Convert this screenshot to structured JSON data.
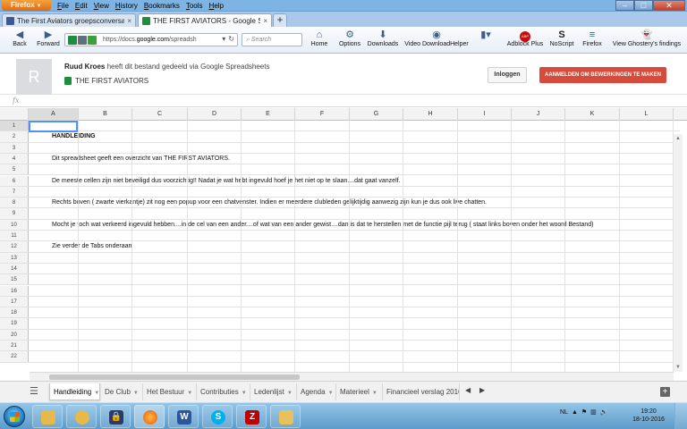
{
  "browser": {
    "app_button": "Firefox",
    "menu": [
      "File",
      "Edit",
      "View",
      "History",
      "Bookmarks",
      "Tools",
      "Help"
    ],
    "tabs": [
      {
        "label": "The First Aviators groepsconversatie |..."
      },
      {
        "label": "THE FIRST AVIATORS - Google Sprea..."
      }
    ],
    "nav": {
      "back": "Back",
      "forward": "Forward",
      "url_prefix": "https://docs.",
      "url_domain": "google.com",
      "url_suffix": "/spreadsh",
      "search_placeholder": "Search",
      "toolbar_buttons": [
        "Home",
        "Options",
        "Downloads",
        "Video DownloadHelper",
        "Adblock Plus",
        "NoScript",
        "Firefox",
        "View Ghostery's findings"
      ],
      "adblock_badge": "ABP",
      "noscript_glyph": "S"
    }
  },
  "docs": {
    "avatar_letter": "R",
    "owner": "Ruud Kroes",
    "shared_text": " heeft dit bestand gedeeld via Google Spreadsheets",
    "title": "THE FIRST AVIATORS",
    "login": "Inloggen",
    "signup": "AANMELDEN OM BEWERKINGEN TE MAKEN",
    "fx": "fx"
  },
  "grid": {
    "columns": [
      "A",
      "B",
      "C",
      "D",
      "E",
      "F",
      "G",
      "H",
      "I",
      "J",
      "K",
      "L"
    ],
    "rows": [
      {
        "n": "1",
        "text": ""
      },
      {
        "n": "2",
        "text": "HANDLEIDING",
        "bold": true
      },
      {
        "n": "3",
        "text": ""
      },
      {
        "n": "4",
        "text": "Dit spreadsheet  geeft een overzicht van THE FIRST AVIATORS."
      },
      {
        "n": "5",
        "text": ""
      },
      {
        "n": "6",
        "text": "De meeste cellen zijn niet beveiligd dus voorzichtig!! Nadat je wat hebt ingevuld hoef je het niet op te slaan....dat gaat vanzelf."
      },
      {
        "n": "7",
        "text": ""
      },
      {
        "n": "8",
        "text": "Rechts boven ( zwarte vierkantje) zit nog een popup voor een chatvenster. Indien er meerdere clubleden gelijktijdig aanwezig zijn kun je dus ook live chatten."
      },
      {
        "n": "9",
        "text": ""
      },
      {
        "n": "10",
        "text": "Mocht je toch wat verkeerd ingevuld hebben....in de cel van een ander....of wat van een ander gewist....dan is dat te herstellen met de functie pijl terug ( staat links boven onder het woord Bestand)"
      },
      {
        "n": "11",
        "text": ""
      },
      {
        "n": "12",
        "text": "Zie verder de Tabs onderaan"
      },
      {
        "n": "13",
        "text": ""
      },
      {
        "n": "14",
        "text": ""
      },
      {
        "n": "15",
        "text": ""
      },
      {
        "n": "16",
        "text": ""
      },
      {
        "n": "17",
        "text": ""
      },
      {
        "n": "18",
        "text": ""
      },
      {
        "n": "19",
        "text": ""
      },
      {
        "n": "20",
        "text": ""
      },
      {
        "n": "21",
        "text": ""
      },
      {
        "n": "22",
        "text": ""
      }
    ]
  },
  "sheets": [
    "Handleiding",
    "De Club",
    "Het Bestuur",
    "Contributies",
    "Ledenlijst",
    "Agenda",
    "Materieel",
    "Financieel verslag 2016"
  ],
  "taskbar": {
    "tray_lang": "NL",
    "time": "19:20",
    "date": "18-10-2016",
    "apps": [
      "file-explorer",
      "messenger",
      "keepass",
      "firefox",
      "word",
      "skype",
      "filezilla",
      "folder"
    ]
  }
}
